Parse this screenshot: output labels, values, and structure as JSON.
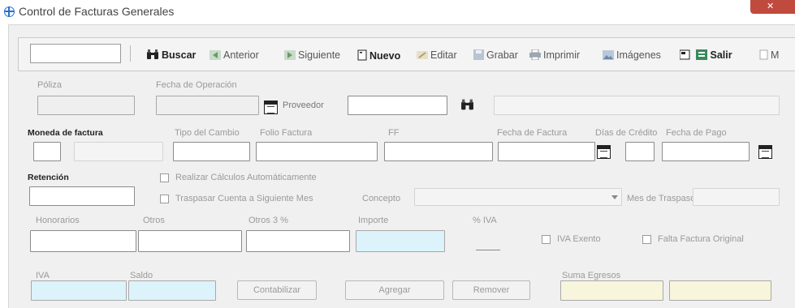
{
  "window": {
    "title": "Control de Facturas Generales"
  },
  "toolbar": {
    "buscar": "Buscar",
    "anterior": "Anterior",
    "siguiente": "Siguiente",
    "nuevo": "Nuevo",
    "editar": "Editar",
    "grabar": "Grabar",
    "imprimir": "Imprimir",
    "imagenes": "Imágenes",
    "salir": "Salir",
    "more": "M"
  },
  "form": {
    "poliza": "Póliza",
    "fecha_operacion": "Fecha de Operación",
    "proveedor": "Proveedor",
    "moneda": "Moneda de factura",
    "tipo_cambio": "Tipo del Cambio",
    "folio_factura": "Folio Factura",
    "ff": "FF",
    "fecha_factura": "Fecha de Factura",
    "dias_credito": "Días de Crédito",
    "fecha_pago": "Fecha de Pago",
    "retencion": "Retención",
    "realizar_calculos": "Realizar Cálculos Automáticamente",
    "traspasar_cuenta": "Traspasar Cuenta a Siguiente Mes",
    "concepto": "Concepto",
    "mes_traspaso": "Mes de Traspaso",
    "honorarios": "Honorarios",
    "otros": "Otros",
    "otros3": "Otros 3 %",
    "importe": "Importe",
    "pct_iva": "% IVA",
    "iva_exento": "IVA Exento",
    "falta_factura": "Falta Factura Original",
    "iva": "IVA",
    "saldo": "Saldo",
    "contabilizar": "Contabilizar",
    "agregar": "Agregar",
    "remover": "Remover",
    "suma_egresos": "Suma Egresos"
  },
  "colors": {
    "cyan_field": "#dcf3fb",
    "yellow_field": "#f7f6dc",
    "close": "#c14a3e",
    "title_icon": "#2a6fd0"
  }
}
